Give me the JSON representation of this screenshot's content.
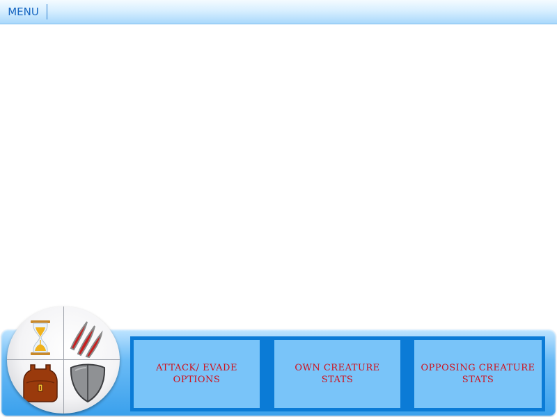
{
  "menu": {
    "label": "MENU"
  },
  "hud": {
    "options": [
      {
        "label": "ATTACK/ EVADE\nOPTIONS"
      },
      {
        "label": "OWN CREATURE\nSTATS"
      },
      {
        "label": "OPPOSING CREATURE\nSTATS"
      }
    ],
    "wheel_icons": [
      "hourglass-icon",
      "claw-marks-icon",
      "backpack-icon",
      "shield-icon"
    ]
  },
  "colors": {
    "option_text": "#d0101a",
    "panel_fill": "#79c4f9",
    "panel_frame": "#0b7bd6",
    "menu_text": "#1565c0"
  }
}
